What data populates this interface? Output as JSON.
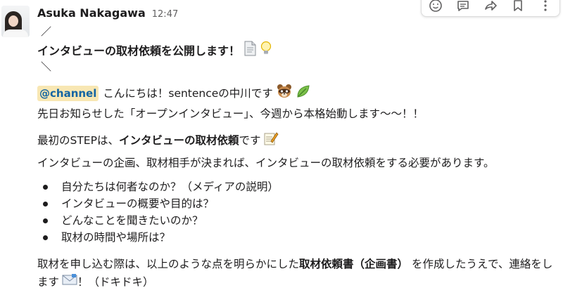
{
  "message": {
    "author": "Asuka Nakagawa",
    "time": "12:47",
    "slash_top": "／",
    "title": "インタビューの取材依頼を公開します！",
    "slash_bottom": "＼",
    "mention": "@channel",
    "greeting": "こんにちは！sentenceの中川です",
    "line2": "先日お知らせした「オープンインタビュー」、今週から本格始動します〜〜！！",
    "line3_prefix": "最初のSTEPは、",
    "line3_bold": "インタビューの取材依頼",
    "line3_suffix": " です",
    "line4": "インタビューの企画、取材相手が決まれば、インタビューの取材依頼をする必要があります。",
    "bullets": [
      "自分たちは何者なのか？（メディアの説明）",
      "インタビューの概要や目的は？",
      "どんなことを聞きたいのか？",
      "取材の時間や場所は？"
    ],
    "closing_prefix": "取材を申し込む際は、以上のような点を明らかにした",
    "closing_bold": "取材依頼書（企画書）",
    "closing_suffix": " を作成したうえで、連絡をします",
    "closing_end": "！（ドキドキ）"
  },
  "toolbar": {
    "icons": [
      "emoji-reaction-icon",
      "reply-thread-icon",
      "share-icon",
      "bookmark-icon",
      "more-icon"
    ]
  },
  "colors": {
    "mention_bg": "#f8e7b3",
    "mention_text": "#1264a3",
    "text": "#1d1c1d",
    "meta": "#616061"
  }
}
